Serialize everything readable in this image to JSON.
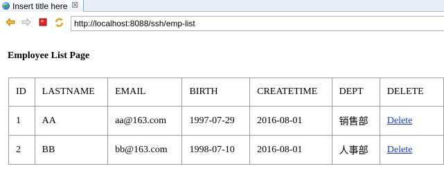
{
  "tab": {
    "title": "Insert title here",
    "close_glyph": "☒"
  },
  "toolbar": {
    "back_icon": "back-arrow-icon",
    "forward_icon": "forward-arrow-icon",
    "stop_icon": "stop-icon",
    "refresh_icon": "refresh-icon",
    "url": "http://localhost:8088/ssh/emp-list"
  },
  "page": {
    "heading": "Employee List Page",
    "columns": [
      "ID",
      "LASTNAME",
      "EMAIL",
      "BIRTH",
      "CREATETIME",
      "DEPT",
      "DELETE"
    ],
    "rows": [
      {
        "id": "1",
        "lastname": "AA",
        "email": "aa@163.com",
        "birth": "1997-07-29",
        "createtime": "2016-08-01",
        "dept": "销售部",
        "delete": "Delete"
      },
      {
        "id": "2",
        "lastname": "BB",
        "email": "bb@163.com",
        "birth": "1998-07-10",
        "createtime": "2016-08-01",
        "dept": "人事部",
        "delete": "Delete"
      }
    ]
  },
  "colors": {
    "link": "#1a3cc9",
    "border": "#9b9b9b",
    "stop": "#d9262b",
    "nav_arrow": "#e0a526"
  }
}
